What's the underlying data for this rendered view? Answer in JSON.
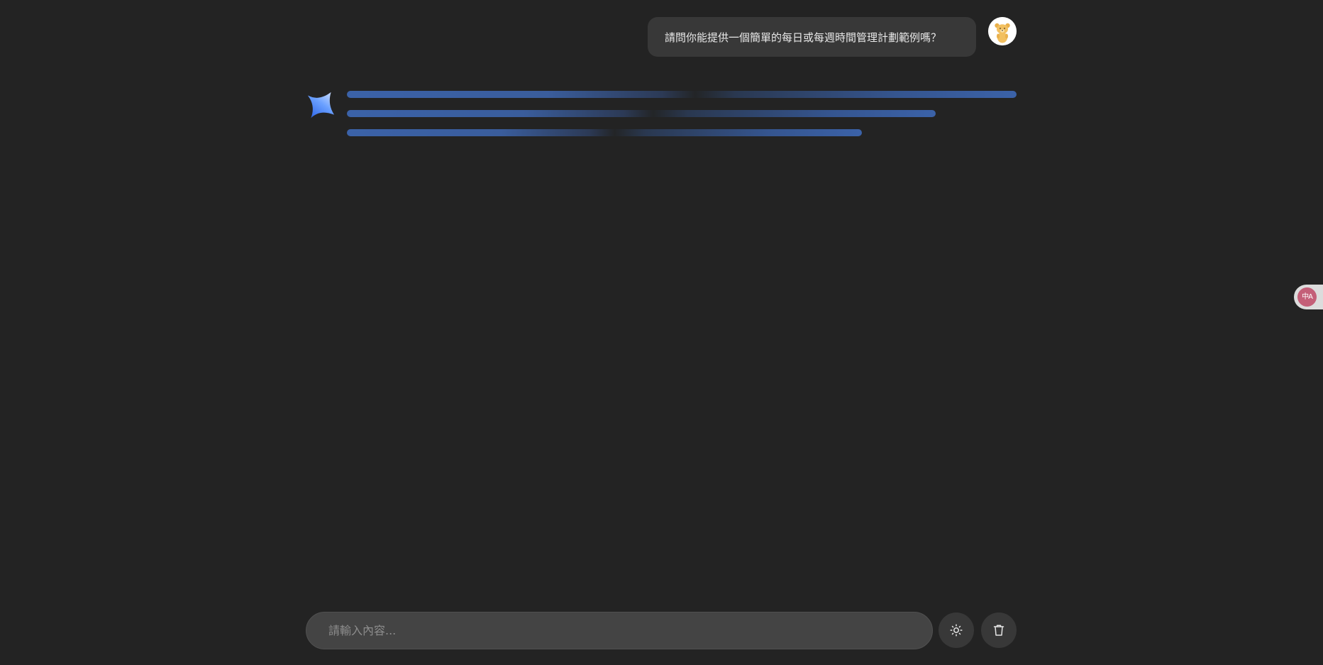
{
  "conversation": {
    "user_message": {
      "text": "請問你能提供一個簡單的每日或每週時間管理計劃範例嗎？",
      "avatar_icon": "bear-avatar-icon"
    },
    "assistant_message": {
      "state": "loading",
      "icon": "sparkle-icon",
      "loading_lines": 3
    }
  },
  "translate_widget": {
    "label": "中A",
    "icon": "translate-icon"
  },
  "composer": {
    "placeholder": "請輸入內容...",
    "value": "",
    "theme_button_icon": "sun-icon",
    "clear_button_icon": "trash-icon"
  },
  "colors": {
    "background": "#232323",
    "user_bubble": "#383838",
    "skeleton_accent": "#3b62a8",
    "input_background": "#444444",
    "button_background": "#383838",
    "translate_badge": "#c45f78"
  }
}
